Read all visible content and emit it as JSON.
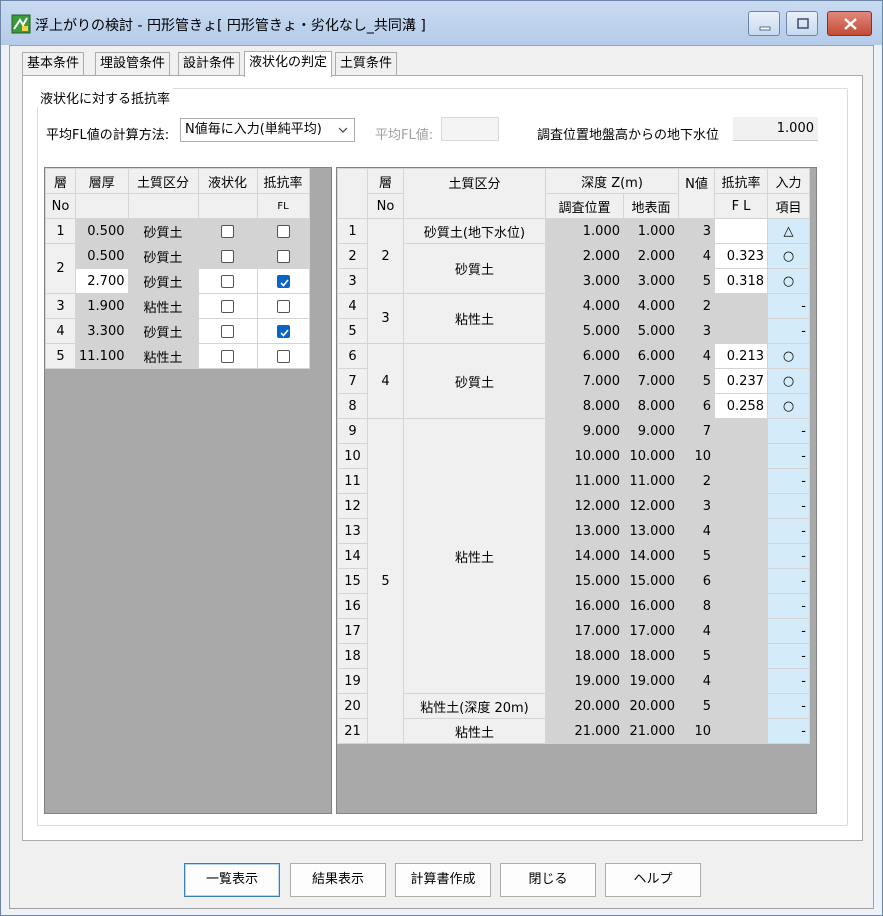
{
  "window": {
    "title": "浮上がりの検討 - 円形管きょ[ 円形管きょ・劣化なし_共同溝 ]"
  },
  "tabs": [
    "基本条件",
    "埋設管条件",
    "設計条件",
    "液状化の判定",
    "土質条件"
  ],
  "active_tab": 3,
  "group_label": "液状化に対する抵抗率",
  "calc_method": {
    "label": "平均FL値の計算方法:",
    "value": "N値毎に入力(単純平均)"
  },
  "avg_fl": {
    "label": "平均FL値:",
    "value": ""
  },
  "groundwater": {
    "label": "調査位置地盤高からの地下水位",
    "value": "1.000"
  },
  "left_grid": {
    "headers": [
      [
        "層",
        "層厚",
        "土質区分",
        "液状化",
        "抵抗率"
      ],
      [
        "No",
        "",
        "",
        "",
        "FL"
      ]
    ],
    "rows": [
      {
        "no": "1",
        "thickness": "0.500",
        "soil": "砂質土",
        "liq": false,
        "fl": false
      },
      {
        "no": "2",
        "thickness": "0.500",
        "soil": "砂質土",
        "liq": false,
        "fl": false
      },
      {
        "no": "",
        "thickness": "2.700",
        "soil": "砂質土",
        "liq": false,
        "fl": true
      },
      {
        "no": "3",
        "thickness": "1.900",
        "soil": "粘性土",
        "liq": false,
        "fl": false
      },
      {
        "no": "4",
        "thickness": "3.300",
        "soil": "砂質土",
        "liq": false,
        "fl": true
      },
      {
        "no": "5",
        "thickness": "11.100",
        "soil": "粘性土",
        "liq": false,
        "fl": false
      }
    ]
  },
  "right_grid": {
    "headers": {
      "layer": "層",
      "layer_no": "No",
      "soil": "土質区分",
      "depth": "深度 Z(m)",
      "survey": "調査位置",
      "surface": "地表面",
      "n": "N値",
      "fl": "抵抗率",
      "fl_sub": "F L",
      "input": "入力",
      "input_sub": "項目"
    },
    "layers": [
      {
        "row": 1,
        "span": 3,
        "no": "2"
      },
      {
        "row": 4,
        "span": 2,
        "no": "3"
      },
      {
        "row": 6,
        "span": 3,
        "no": "4"
      },
      {
        "row": 9,
        "span": 13,
        "no": "5"
      }
    ],
    "soils": [
      {
        "row": 1,
        "span": 1,
        "text": "砂質土(地下水位)"
      },
      {
        "row": 2,
        "span": 2,
        "text": "砂質土"
      },
      {
        "row": 4,
        "span": 2,
        "text": "粘性土"
      },
      {
        "row": 6,
        "span": 3,
        "text": "砂質土"
      },
      {
        "row": 9,
        "span": 11,
        "text": "粘性土"
      },
      {
        "row": 20,
        "span": 1,
        "text": "粘性土(深度 20m)"
      },
      {
        "row": 21,
        "span": 1,
        "text": "粘性土"
      }
    ],
    "rows": [
      {
        "i": "1",
        "survey": "1.000",
        "surface": "1.000",
        "n": "3",
        "fl": "",
        "input": "△"
      },
      {
        "i": "2",
        "survey": "2.000",
        "surface": "2.000",
        "n": "4",
        "fl": "0.323",
        "input": "○"
      },
      {
        "i": "3",
        "survey": "3.000",
        "surface": "3.000",
        "n": "5",
        "fl": "0.318",
        "input": "○"
      },
      {
        "i": "4",
        "survey": "4.000",
        "surface": "4.000",
        "n": "2",
        "fl": "",
        "input": "-"
      },
      {
        "i": "5",
        "survey": "5.000",
        "surface": "5.000",
        "n": "3",
        "fl": "",
        "input": "-"
      },
      {
        "i": "6",
        "survey": "6.000",
        "surface": "6.000",
        "n": "4",
        "fl": "0.213",
        "input": "○"
      },
      {
        "i": "7",
        "survey": "7.000",
        "surface": "7.000",
        "n": "5",
        "fl": "0.237",
        "input": "○"
      },
      {
        "i": "8",
        "survey": "8.000",
        "surface": "8.000",
        "n": "6",
        "fl": "0.258",
        "input": "○"
      },
      {
        "i": "9",
        "survey": "9.000",
        "surface": "9.000",
        "n": "7",
        "fl": "",
        "input": "-"
      },
      {
        "i": "10",
        "survey": "10.000",
        "surface": "10.000",
        "n": "10",
        "fl": "",
        "input": "-"
      },
      {
        "i": "11",
        "survey": "11.000",
        "surface": "11.000",
        "n": "2",
        "fl": "",
        "input": "-"
      },
      {
        "i": "12",
        "survey": "12.000",
        "surface": "12.000",
        "n": "3",
        "fl": "",
        "input": "-"
      },
      {
        "i": "13",
        "survey": "13.000",
        "surface": "13.000",
        "n": "4",
        "fl": "",
        "input": "-"
      },
      {
        "i": "14",
        "survey": "14.000",
        "surface": "14.000",
        "n": "5",
        "fl": "",
        "input": "-"
      },
      {
        "i": "15",
        "survey": "15.000",
        "surface": "15.000",
        "n": "6",
        "fl": "",
        "input": "-"
      },
      {
        "i": "16",
        "survey": "16.000",
        "surface": "16.000",
        "n": "8",
        "fl": "",
        "input": "-"
      },
      {
        "i": "17",
        "survey": "17.000",
        "surface": "17.000",
        "n": "4",
        "fl": "",
        "input": "-"
      },
      {
        "i": "18",
        "survey": "18.000",
        "surface": "18.000",
        "n": "5",
        "fl": "",
        "input": "-"
      },
      {
        "i": "19",
        "survey": "19.000",
        "surface": "19.000",
        "n": "4",
        "fl": "",
        "input": "-"
      },
      {
        "i": "20",
        "survey": "20.000",
        "surface": "20.000",
        "n": "5",
        "fl": "",
        "input": "-"
      },
      {
        "i": "21",
        "survey": "21.000",
        "surface": "21.000",
        "n": "10",
        "fl": "",
        "input": "-"
      }
    ]
  },
  "buttons": [
    "一覧表示",
    "結果表示",
    "計算書作成",
    "閉じる",
    "ヘルプ"
  ]
}
